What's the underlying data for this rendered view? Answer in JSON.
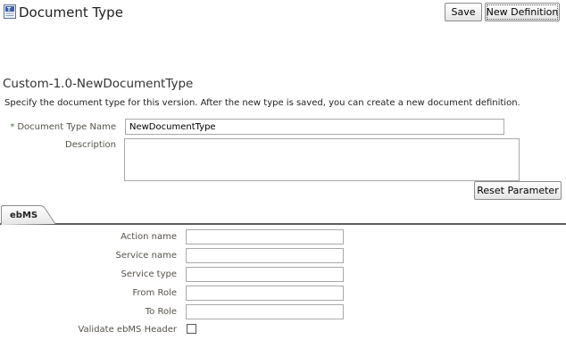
{
  "header": {
    "title": "Document Type",
    "save_label": "Save",
    "new_definition_label": "New Definition"
  },
  "section": {
    "title": "Custom-1.0-NewDocumentType",
    "description": "Specify the document type for this version. After the new type is saved, you can create a new document definition."
  },
  "form": {
    "required_marker": "*",
    "document_type_name_label": "Document Type Name",
    "document_type_name_value": "NewDocumentType",
    "description_label": "Description",
    "description_value": "",
    "reset_label": "Reset Parameter"
  },
  "tabs": [
    {
      "label": "ebMS",
      "selected": true
    }
  ],
  "ebms": {
    "action_name_label": "Action name",
    "service_name_label": "Service name",
    "service_type_label": "Service type",
    "from_role_label": "From Role",
    "to_role_label": "To Role",
    "validate_header_label": "Validate ebMS Header",
    "validate_header_checked": false
  }
}
